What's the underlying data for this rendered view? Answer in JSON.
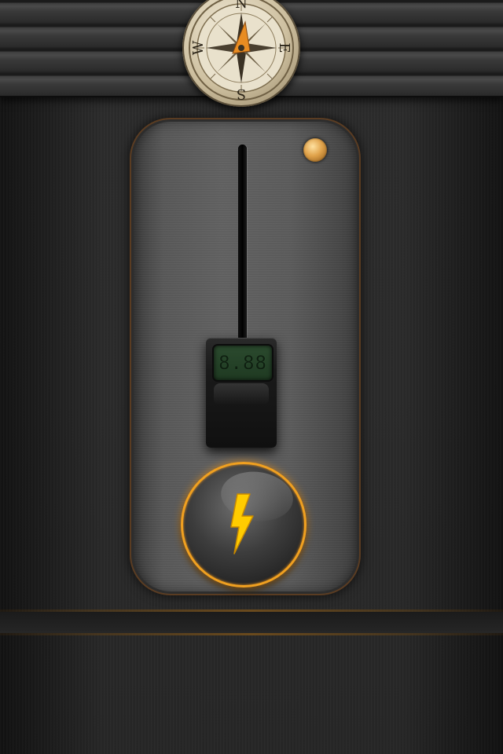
{
  "compass": {
    "north": "N",
    "east": "E",
    "south": "S",
    "west": "W",
    "needle_color": "#e88c22"
  },
  "slider": {
    "lcd_value": "8.88"
  },
  "flash_button": {
    "icon": "lightning-bolt-icon",
    "glow_color": "#f0a020",
    "bolt_color": "#ffcc00"
  },
  "indicator": {
    "icon": "indicator-light-icon",
    "color": "#e0a24a"
  }
}
